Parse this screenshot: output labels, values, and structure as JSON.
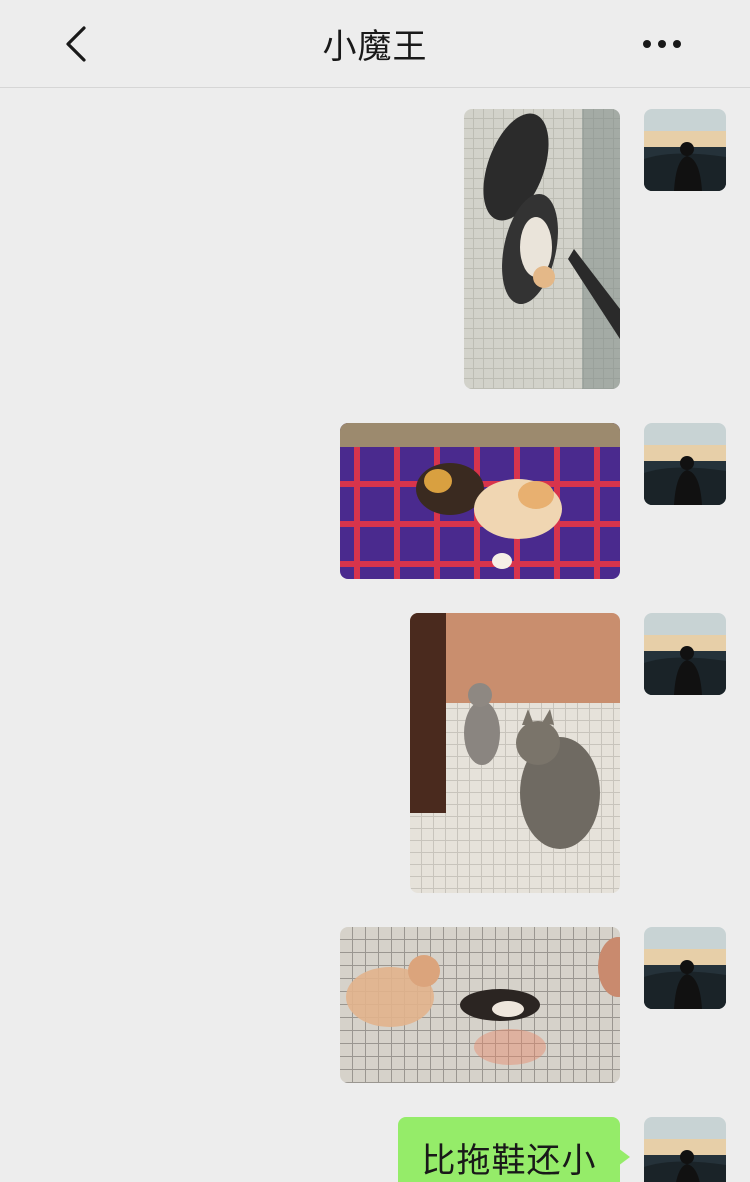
{
  "header": {
    "title": "小魔王",
    "back_icon": "chevron-left-icon",
    "more_icon": "ellipsis-icon"
  },
  "messages": [
    {
      "type": "image",
      "subject": "kitten-between-slippers"
    },
    {
      "type": "image",
      "subject": "two-kittens-on-plaid-blanket"
    },
    {
      "type": "image",
      "subject": "cats-on-tiled-floor"
    },
    {
      "type": "image",
      "subject": "kittens-playing-on-tiles"
    },
    {
      "type": "text",
      "text": "比拖鞋还小"
    }
  ],
  "colors": {
    "background": "#ededed",
    "bubble": "#95ec69",
    "text": "#191919"
  }
}
